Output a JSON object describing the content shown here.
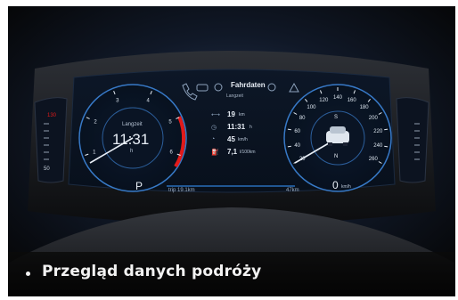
{
  "cluster": {
    "top_menu": {
      "label": "Fahrdaten",
      "sublabel": "Langzeit"
    },
    "clock": {
      "label": "Langzeit",
      "time": "11:31",
      "unit": "h"
    },
    "gear": "P",
    "range_left": "trip 19.1km",
    "range_right": "47km",
    "trip": [
      {
        "icon": "distance-icon",
        "value": "19",
        "unit": "km"
      },
      {
        "icon": "clock-icon",
        "value": "11:31",
        "unit": "h"
      },
      {
        "icon": "speed-icon",
        "value": "45",
        "unit": "km/h"
      },
      {
        "icon": "fuel-icon",
        "value": "7,1",
        "unit": "l/100km"
      }
    ],
    "tachometer_ticks": [
      "1",
      "2",
      "3",
      "4",
      "5",
      "6"
    ],
    "speedometer_ticks": [
      "20",
      "40",
      "60",
      "80",
      "100",
      "120",
      "140",
      "160",
      "180",
      "200",
      "220",
      "240",
      "260"
    ],
    "speed": {
      "value": "0",
      "unit": "km/h"
    },
    "compass_n": "N",
    "compass_s": "S",
    "fuel_tick_bottom": "50",
    "warning_label": "130",
    "accent_red": "#e21a1a",
    "accent_blue": "#2f7fd8"
  },
  "caption": {
    "text": "Przegląd danych podróży"
  }
}
